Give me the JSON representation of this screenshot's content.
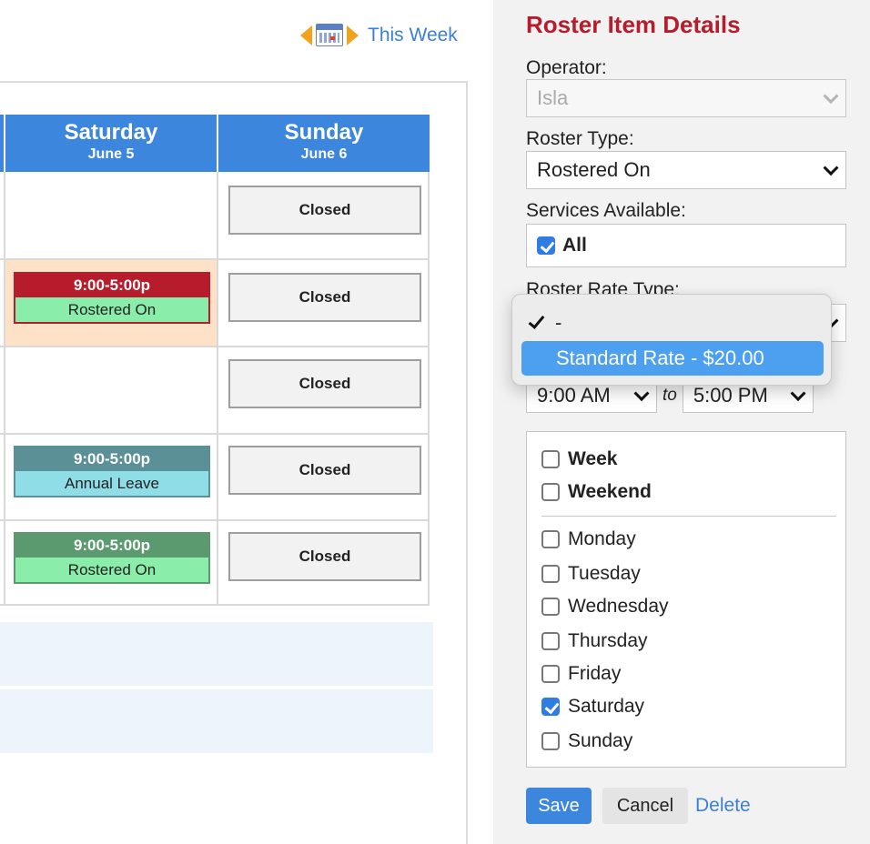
{
  "week_nav": {
    "this_week_label": "This Week"
  },
  "calendar": {
    "columns": [
      {
        "day": "Saturday",
        "date": "June 5"
      },
      {
        "day": "Sunday",
        "date": "June 6"
      }
    ],
    "rows": [
      {
        "saturday": null,
        "sunday": "Closed"
      },
      {
        "saturday": {
          "time": "9:00-5:00p",
          "label": "Rostered On",
          "status": "rostered-on-selected"
        },
        "sunday": "Closed"
      },
      {
        "saturday": null,
        "sunday": "Closed"
      },
      {
        "saturday": {
          "time": "9:00-5:00p",
          "label": "Annual Leave",
          "status": "annual-leave"
        },
        "sunday": "Closed"
      },
      {
        "saturday": {
          "time": "9:00-5:00p",
          "label": "Rostered On",
          "status": "rostered-on"
        },
        "sunday": "Closed"
      }
    ]
  },
  "panel": {
    "title": "Roster Item Details",
    "operator_label": "Operator:",
    "operator_value": "Isla",
    "roster_type_label": "Roster Type:",
    "roster_type_value": "Rostered On",
    "services_label": "Services Available:",
    "services_all_label": "All",
    "rate_type_label": "Roster Rate Type:",
    "rate_options": [
      "-",
      "Standard Rate - $20.00"
    ],
    "rate_selected": "-",
    "rate_highlighted": "Standard Rate - $20.00",
    "start_time": "9:00 AM",
    "to_label": "to",
    "end_time": "5:00 PM",
    "day_groups": [
      {
        "label": "Week",
        "checked": false
      },
      {
        "label": "Weekend",
        "checked": false
      }
    ],
    "days": [
      {
        "label": "Monday",
        "checked": false
      },
      {
        "label": "Tuesday",
        "checked": false
      },
      {
        "label": "Wednesday",
        "checked": false
      },
      {
        "label": "Thursday",
        "checked": false
      },
      {
        "label": "Friday",
        "checked": false
      },
      {
        "label": "Saturday",
        "checked": true
      },
      {
        "label": "Sunday",
        "checked": false
      }
    ],
    "save_label": "Save",
    "cancel_label": "Cancel",
    "delete_label": "Delete"
  },
  "colors": {
    "header_blue": "#3d86de",
    "title_red": "#b71c2c",
    "rostered_on_selected_time": "#b71c2c",
    "rostered_on_time": "#5a9a6e",
    "annual_leave_time": "#5a9096",
    "rostered_on_bg": "#8aeeaa",
    "annual_leave_bg": "#8fdde6",
    "selected_cell_bg": "#fde2c8",
    "link_blue": "#3b7fd6"
  }
}
